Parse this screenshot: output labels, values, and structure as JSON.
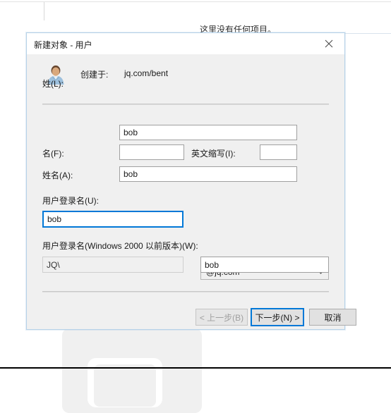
{
  "background": {
    "empty_text": "这里没有任何项目。"
  },
  "dialog": {
    "title": "新建对象 - 用户",
    "close_icon": "close-icon",
    "identity": {
      "avatar_icon": "user-avatar-icon",
      "created_in_label": "创建于:",
      "created_in_value": "jq.com/bent"
    },
    "fields": {
      "first_name_label": "姓(L):",
      "first_name_value": "bob",
      "last_name_label": "名(F):",
      "last_name_value": "",
      "initials_label": "英文缩写(I):",
      "initials_value": "",
      "full_name_label": "姓名(A):",
      "full_name_value": "bob",
      "logon_name_label": "用户登录名(U):",
      "logon_name_value": "bob",
      "logon_suffix_value": "@jq.com",
      "logon_suffix_arrow_icon": "chevron-down-icon",
      "downlevel_label": "用户登录名(Windows 2000 以前版本)(W):",
      "downlevel_domain_value": "JQ\\",
      "downlevel_name_value": "bob"
    },
    "buttons": {
      "back": "< 上一步(B)",
      "next": "下一步(N) >",
      "cancel": "取消"
    }
  },
  "colors": {
    "accent": "#0078d7",
    "dialog_bg": "#f0f0f0",
    "field_border": "#a0a0a0"
  }
}
